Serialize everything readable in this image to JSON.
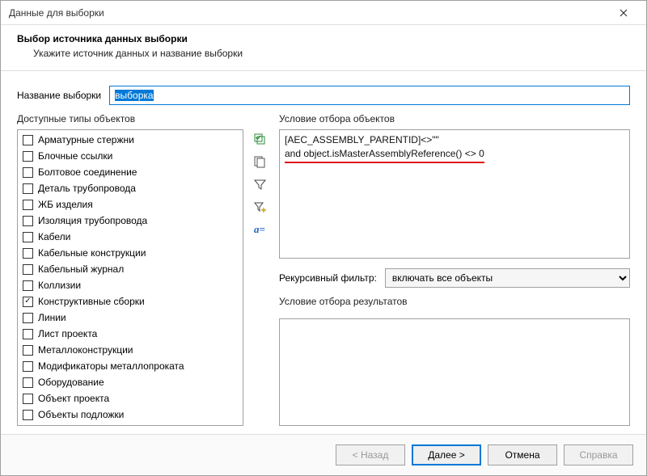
{
  "window": {
    "title": "Данные для выборки"
  },
  "header": {
    "title": "Выбор источника данных выборки",
    "subtitle": "Укажите источник данных и название выборки"
  },
  "name_row": {
    "label": "Название выборки",
    "value": "выборка"
  },
  "available_types": {
    "label": "Доступные типы объектов",
    "items": [
      {
        "label": "Арматурные стержни",
        "checked": false
      },
      {
        "label": "Блочные ссылки",
        "checked": false
      },
      {
        "label": "Болтовое соединение",
        "checked": false
      },
      {
        "label": "Деталь трубопровода",
        "checked": false
      },
      {
        "label": "ЖБ изделия",
        "checked": false
      },
      {
        "label": "Изоляция трубопровода",
        "checked": false
      },
      {
        "label": "Кабели",
        "checked": false
      },
      {
        "label": "Кабельные конструкции",
        "checked": false
      },
      {
        "label": "Кабельный журнал",
        "checked": false
      },
      {
        "label": "Коллизии",
        "checked": false
      },
      {
        "label": "Конструктивные сборки",
        "checked": true
      },
      {
        "label": "Линии",
        "checked": false
      },
      {
        "label": "Лист проекта",
        "checked": false
      },
      {
        "label": "Металлоконструкции",
        "checked": false
      },
      {
        "label": "Модификаторы металлопроката",
        "checked": false
      },
      {
        "label": "Оборудование",
        "checked": false
      },
      {
        "label": "Объект проекта",
        "checked": false
      },
      {
        "label": "Объекты подложки",
        "checked": false
      }
    ]
  },
  "toolbar_icons": {
    "check_all": "check-all-icon",
    "copy": "copy-icon",
    "filter": "filter-icon",
    "filter_plus": "filter-plus-icon",
    "formula": "formula-icon"
  },
  "condition": {
    "label": "Условие отбора объектов",
    "line1": "[AEC_ASSEMBLY_PARENTID]<>\"\"",
    "line2": "and object.isMasterAssemblyReference() <> 0"
  },
  "recursive_filter": {
    "label": "Рекурсивный фильтр:",
    "selected": "включать все объекты"
  },
  "result_condition": {
    "label": "Условие отбора результатов"
  },
  "footer": {
    "back": "< Назад",
    "next": "Далее >",
    "cancel": "Отмена",
    "help": "Справка"
  }
}
